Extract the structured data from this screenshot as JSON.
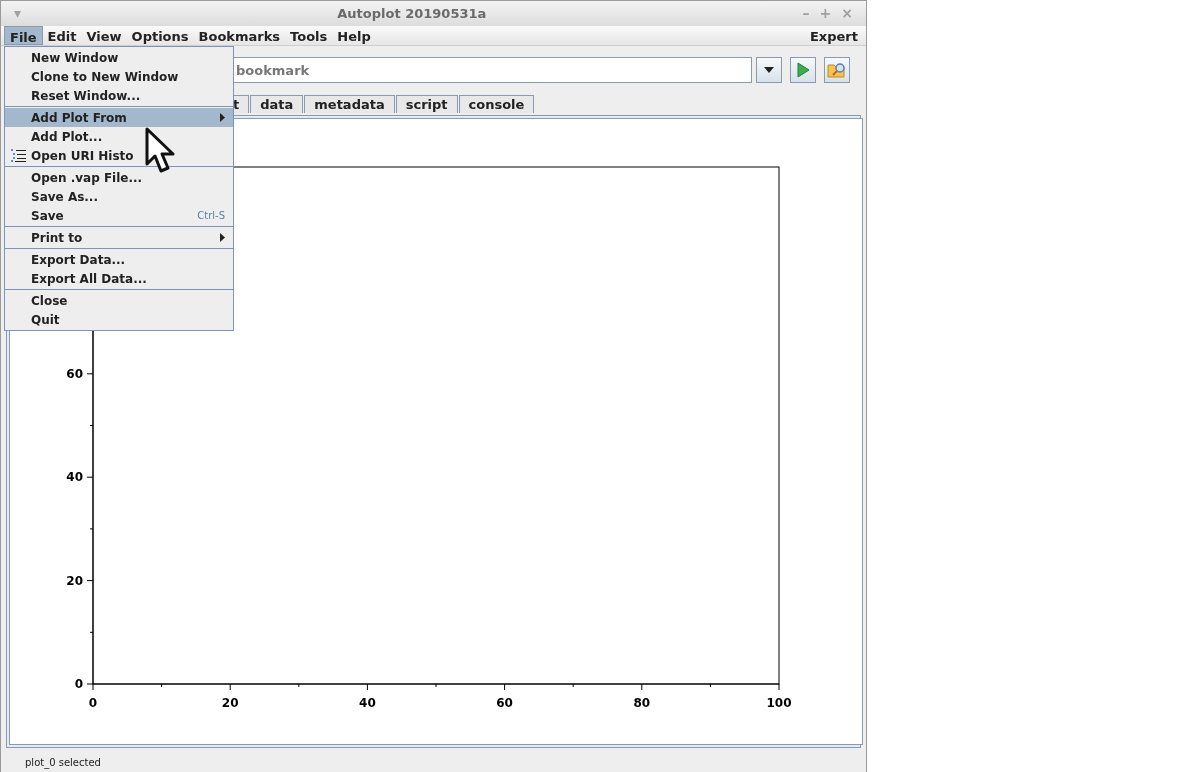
{
  "window": {
    "menu_glyph": "▾",
    "title": "Autoplot 20190531a",
    "buttons": [
      "–",
      "+",
      "×"
    ]
  },
  "menubar": [
    {
      "label": "File",
      "selected": true
    },
    {
      "label": "Edit",
      "selected": false
    },
    {
      "label": "View",
      "selected": false
    },
    {
      "label": "Options",
      "selected": false
    },
    {
      "label": "Bookmarks",
      "selected": false
    },
    {
      "label": "Tools",
      "selected": false
    },
    {
      "label": "Help",
      "selected": false
    }
  ],
  "menubar_right": "Expert",
  "address": {
    "text": "bookmark"
  },
  "tabs": [
    {
      "label": "t",
      "selected": false
    },
    {
      "label": "data",
      "selected": false
    },
    {
      "label": "metadata",
      "selected": false
    },
    {
      "label": "script",
      "selected": false
    },
    {
      "label": "console",
      "selected": false
    }
  ],
  "plot": {
    "chart_data": {
      "type": "line",
      "xlim": [
        0,
        100
      ],
      "ylim": [
        0,
        100
      ],
      "xticks": [
        0,
        20,
        40,
        60,
        80,
        100
      ],
      "yticks": [
        0,
        20,
        40,
        60
      ]
    }
  },
  "file_menu": [
    [
      {
        "label": "New Window",
        "kind": "command",
        "submenu": false,
        "selected": false
      },
      {
        "label": "Clone to New Window",
        "kind": "command",
        "submenu": false,
        "selected": false
      },
      {
        "label": "Reset Window...",
        "kind": "command",
        "submenu": false,
        "selected": false
      }
    ],
    [
      {
        "label": "Add Plot From",
        "kind": "command",
        "submenu": true,
        "selected": true
      },
      {
        "label": "Add Plot...",
        "kind": "command",
        "submenu": false,
        "selected": false
      },
      {
        "label": "Open URI Histo",
        "kind": "history",
        "submenu": false,
        "selected": false
      }
    ],
    [
      {
        "label": "Open .vap File...",
        "kind": "command",
        "submenu": false,
        "selected": false
      },
      {
        "label": "Save As...",
        "kind": "command",
        "submenu": false,
        "selected": false
      },
      {
        "label": "Save",
        "kind": "command",
        "submenu": false,
        "selected": false,
        "shortcut": "Ctrl-S"
      }
    ],
    [
      {
        "label": "Print to",
        "kind": "command",
        "submenu": true,
        "selected": false
      }
    ],
    [
      {
        "label": "Export Data...",
        "kind": "command",
        "submenu": false,
        "selected": false
      },
      {
        "label": "Export All Data...",
        "kind": "command",
        "submenu": false,
        "selected": false
      }
    ],
    [
      {
        "label": "Close",
        "kind": "command",
        "submenu": false,
        "selected": false
      },
      {
        "label": "Quit",
        "kind": "command",
        "submenu": false,
        "selected": false
      }
    ]
  ],
  "status_bar": "plot_0 selected"
}
